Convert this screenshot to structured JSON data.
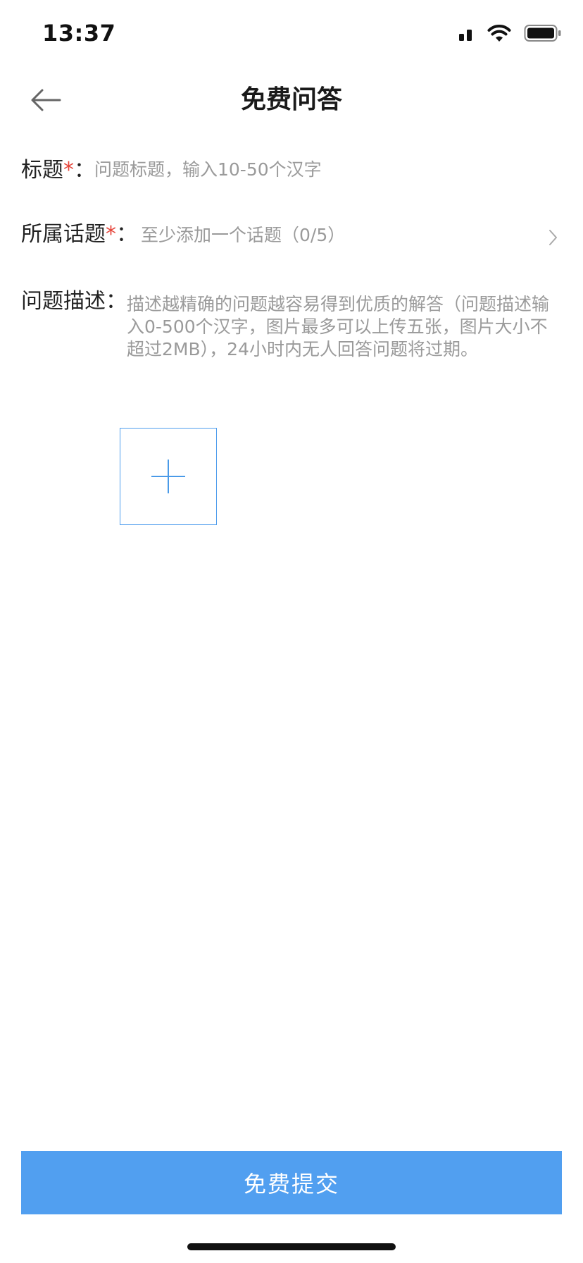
{
  "status_bar": {
    "time": "13:37",
    "icons": [
      "cellular-signal-icon",
      "wifi-icon",
      "battery-icon"
    ]
  },
  "nav": {
    "title": "免费问答",
    "back_icon": "arrow-left-icon"
  },
  "form": {
    "title_field": {
      "label": "标题",
      "required_mark": "*",
      "colon": "：",
      "placeholder": "问题标题，输入10-50个汉字",
      "value": ""
    },
    "topic_field": {
      "label": "所属话题",
      "required_mark": "*",
      "colon": "：",
      "placeholder": "至少添加一个话题（0/5）",
      "chevron_icon": "chevron-right-icon"
    },
    "description_field": {
      "label": "问题描述",
      "colon": "：",
      "placeholder": "描述越精确的问题越容易得到优质的解答（问题描述输入0-500个汉字，图片最多可以上传五张，图片大小不超过2MB），24小时内无人回答问题将过期。",
      "value": ""
    },
    "image_upload": {
      "icon": "plus-icon"
    }
  },
  "submit": {
    "label": "免费提交"
  },
  "colors": {
    "accent": "#519ff0",
    "upload_border": "#4f9ded",
    "required": "#e5453a",
    "placeholder": "#9a9a9a"
  }
}
